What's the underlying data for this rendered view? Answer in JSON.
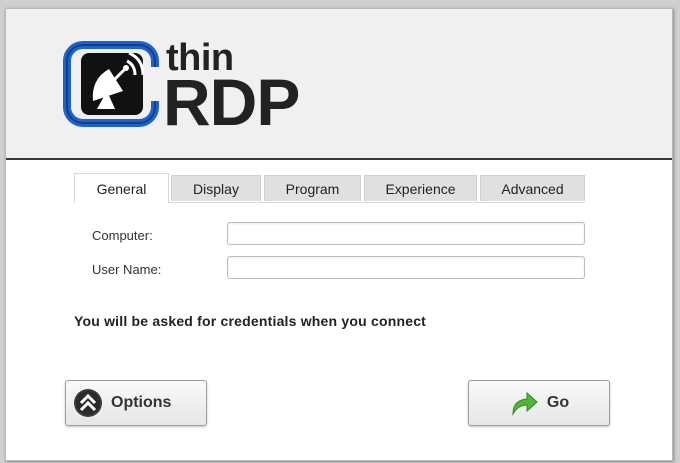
{
  "logo": {
    "word_top": "thin",
    "word_bottom": "RDP"
  },
  "tabs": [
    {
      "label": "General",
      "active": true
    },
    {
      "label": "Display",
      "active": false
    },
    {
      "label": "Program",
      "active": false
    },
    {
      "label": "Experience",
      "active": false
    },
    {
      "label": "Advanced",
      "active": false
    }
  ],
  "form": {
    "computer_label": "Computer:",
    "computer_value": "",
    "username_label": "User Name:",
    "username_value": ""
  },
  "message": "You will be asked for credentials when you connect",
  "buttons": {
    "options_label": "Options",
    "options_icon": "double-chevron-up-icon",
    "go_label": "Go",
    "go_icon": "green-arrow-icon"
  },
  "colors": {
    "logo_blue": "#1f63c9",
    "go_arrow_green": "#4fb73a"
  }
}
